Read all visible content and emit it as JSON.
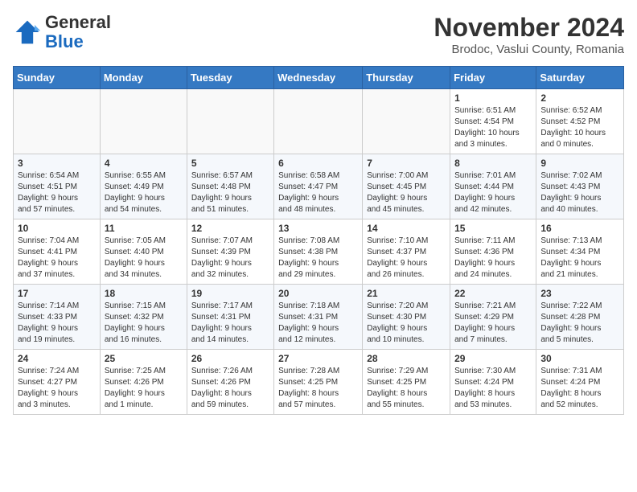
{
  "logo": {
    "general": "General",
    "blue": "Blue"
  },
  "header": {
    "month": "November 2024",
    "location": "Brodoc, Vaslui County, Romania"
  },
  "weekdays": [
    "Sunday",
    "Monday",
    "Tuesday",
    "Wednesday",
    "Thursday",
    "Friday",
    "Saturday"
  ],
  "weeks": [
    [
      {
        "day": "",
        "info": ""
      },
      {
        "day": "",
        "info": ""
      },
      {
        "day": "",
        "info": ""
      },
      {
        "day": "",
        "info": ""
      },
      {
        "day": "",
        "info": ""
      },
      {
        "day": "1",
        "info": "Sunrise: 6:51 AM\nSunset: 4:54 PM\nDaylight: 10 hours\nand 3 minutes."
      },
      {
        "day": "2",
        "info": "Sunrise: 6:52 AM\nSunset: 4:52 PM\nDaylight: 10 hours\nand 0 minutes."
      }
    ],
    [
      {
        "day": "3",
        "info": "Sunrise: 6:54 AM\nSunset: 4:51 PM\nDaylight: 9 hours\nand 57 minutes."
      },
      {
        "day": "4",
        "info": "Sunrise: 6:55 AM\nSunset: 4:49 PM\nDaylight: 9 hours\nand 54 minutes."
      },
      {
        "day": "5",
        "info": "Sunrise: 6:57 AM\nSunset: 4:48 PM\nDaylight: 9 hours\nand 51 minutes."
      },
      {
        "day": "6",
        "info": "Sunrise: 6:58 AM\nSunset: 4:47 PM\nDaylight: 9 hours\nand 48 minutes."
      },
      {
        "day": "7",
        "info": "Sunrise: 7:00 AM\nSunset: 4:45 PM\nDaylight: 9 hours\nand 45 minutes."
      },
      {
        "day": "8",
        "info": "Sunrise: 7:01 AM\nSunset: 4:44 PM\nDaylight: 9 hours\nand 42 minutes."
      },
      {
        "day": "9",
        "info": "Sunrise: 7:02 AM\nSunset: 4:43 PM\nDaylight: 9 hours\nand 40 minutes."
      }
    ],
    [
      {
        "day": "10",
        "info": "Sunrise: 7:04 AM\nSunset: 4:41 PM\nDaylight: 9 hours\nand 37 minutes."
      },
      {
        "day": "11",
        "info": "Sunrise: 7:05 AM\nSunset: 4:40 PM\nDaylight: 9 hours\nand 34 minutes."
      },
      {
        "day": "12",
        "info": "Sunrise: 7:07 AM\nSunset: 4:39 PM\nDaylight: 9 hours\nand 32 minutes."
      },
      {
        "day": "13",
        "info": "Sunrise: 7:08 AM\nSunset: 4:38 PM\nDaylight: 9 hours\nand 29 minutes."
      },
      {
        "day": "14",
        "info": "Sunrise: 7:10 AM\nSunset: 4:37 PM\nDaylight: 9 hours\nand 26 minutes."
      },
      {
        "day": "15",
        "info": "Sunrise: 7:11 AM\nSunset: 4:36 PM\nDaylight: 9 hours\nand 24 minutes."
      },
      {
        "day": "16",
        "info": "Sunrise: 7:13 AM\nSunset: 4:34 PM\nDaylight: 9 hours\nand 21 minutes."
      }
    ],
    [
      {
        "day": "17",
        "info": "Sunrise: 7:14 AM\nSunset: 4:33 PM\nDaylight: 9 hours\nand 19 minutes."
      },
      {
        "day": "18",
        "info": "Sunrise: 7:15 AM\nSunset: 4:32 PM\nDaylight: 9 hours\nand 16 minutes."
      },
      {
        "day": "19",
        "info": "Sunrise: 7:17 AM\nSunset: 4:31 PM\nDaylight: 9 hours\nand 14 minutes."
      },
      {
        "day": "20",
        "info": "Sunrise: 7:18 AM\nSunset: 4:31 PM\nDaylight: 9 hours\nand 12 minutes."
      },
      {
        "day": "21",
        "info": "Sunrise: 7:20 AM\nSunset: 4:30 PM\nDaylight: 9 hours\nand 10 minutes."
      },
      {
        "day": "22",
        "info": "Sunrise: 7:21 AM\nSunset: 4:29 PM\nDaylight: 9 hours\nand 7 minutes."
      },
      {
        "day": "23",
        "info": "Sunrise: 7:22 AM\nSunset: 4:28 PM\nDaylight: 9 hours\nand 5 minutes."
      }
    ],
    [
      {
        "day": "24",
        "info": "Sunrise: 7:24 AM\nSunset: 4:27 PM\nDaylight: 9 hours\nand 3 minutes."
      },
      {
        "day": "25",
        "info": "Sunrise: 7:25 AM\nSunset: 4:26 PM\nDaylight: 9 hours\nand 1 minute."
      },
      {
        "day": "26",
        "info": "Sunrise: 7:26 AM\nSunset: 4:26 PM\nDaylight: 8 hours\nand 59 minutes."
      },
      {
        "day": "27",
        "info": "Sunrise: 7:28 AM\nSunset: 4:25 PM\nDaylight: 8 hours\nand 57 minutes."
      },
      {
        "day": "28",
        "info": "Sunrise: 7:29 AM\nSunset: 4:25 PM\nDaylight: 8 hours\nand 55 minutes."
      },
      {
        "day": "29",
        "info": "Sunrise: 7:30 AM\nSunset: 4:24 PM\nDaylight: 8 hours\nand 53 minutes."
      },
      {
        "day": "30",
        "info": "Sunrise: 7:31 AM\nSunset: 4:24 PM\nDaylight: 8 hours\nand 52 minutes."
      }
    ]
  ]
}
